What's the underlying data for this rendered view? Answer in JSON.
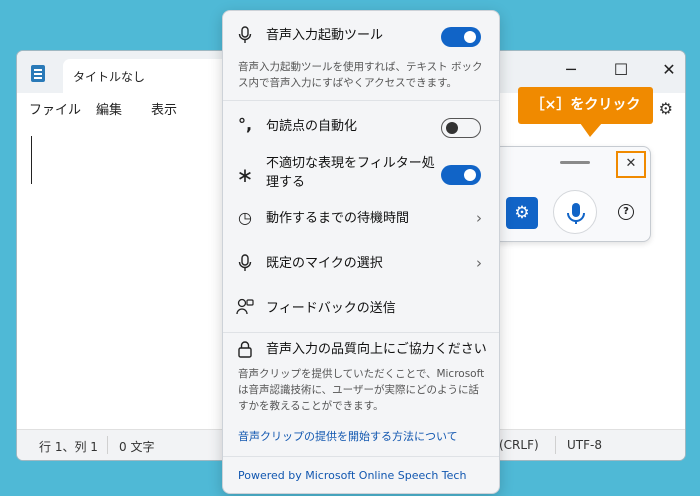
{
  "notepad": {
    "tab_title": "タイトルなし",
    "menu": [
      "ファイル",
      "編集",
      "表示"
    ],
    "status": {
      "position": "行 1、列 1",
      "chars": "0 文字",
      "line_ending": "(CRLF)",
      "encoding": "UTF-8"
    }
  },
  "flyout": {
    "launcher": {
      "label": "音声入力起動ツール",
      "enabled": true,
      "description": "音声入力起動ツールを使用すれば、テキスト ボックス内で音声入力にすばやくアクセスできます。"
    },
    "auto_punctuation": {
      "label": "句読点の自動化",
      "enabled": false
    },
    "profanity_filter": {
      "label": "不適切な表現をフィルター処理する",
      "enabled": true
    },
    "wait_time": {
      "label": "動作するまでの待機時間"
    },
    "mic_select": {
      "label": "既定のマイクの選択"
    },
    "feedback": {
      "label": "フィードバックの送信"
    },
    "improve": {
      "label": "音声入力の品質向上にご協力ください",
      "description": "音声クリップを提供していただくことで、Microsoft は音声認識技術に、ユーザーが実際にどのように話すかを教えることができます。",
      "link": "音声クリップの提供を開始する方法について"
    },
    "footer": "Powered by Microsoft Online Speech Tech"
  },
  "callout": {
    "text": "［×］をクリック"
  },
  "colors": {
    "accent": "#1164c7",
    "callout": "#f08a00",
    "background": "#4fb9d6"
  },
  "icons": [
    "notepad-app-icon",
    "gear-icon",
    "mic-icon",
    "punctuation-icon",
    "asterisk-icon",
    "timer-icon",
    "chevron-right-icon",
    "feedback-icon",
    "lock-icon",
    "close-icon",
    "help-icon"
  ]
}
